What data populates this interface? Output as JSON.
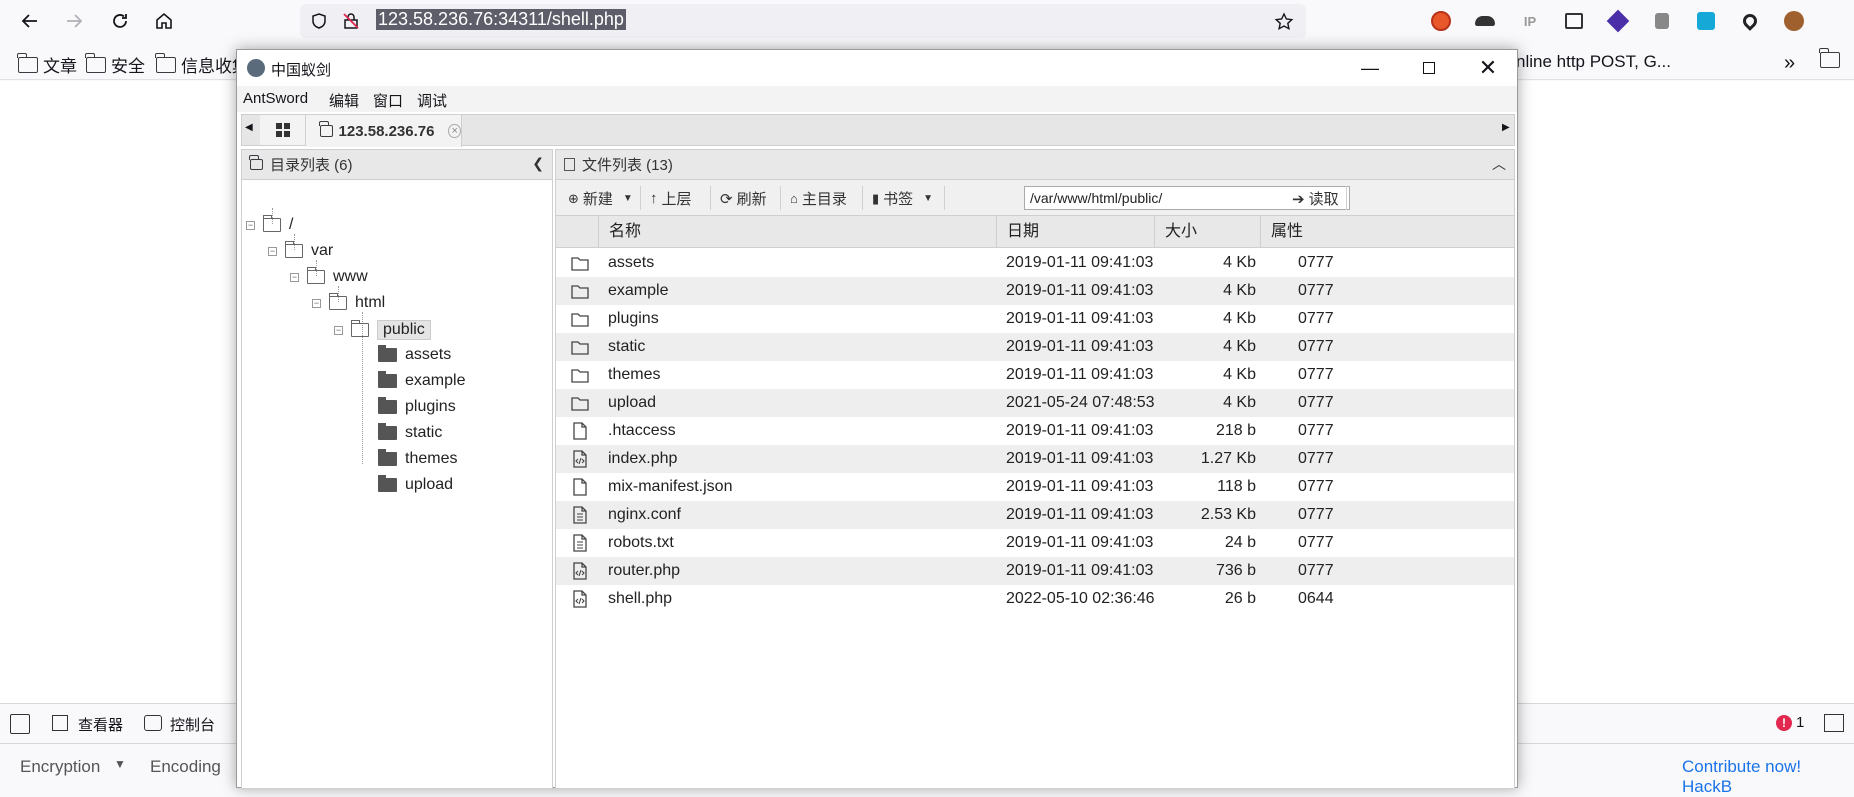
{
  "browser": {
    "url": "123.58.236.76:34311/shell.php",
    "bookmarks": [
      "文章",
      "安全",
      "信息收集"
    ],
    "bookmark_right": "nline http POST, G...",
    "extensions": [
      "ip-ext-label"
    ],
    "ip_label": "IP"
  },
  "antsword": {
    "title": "中国蚁剑",
    "menu": [
      "AntSword",
      "编辑",
      "窗口",
      "调试"
    ],
    "tab_host": "123.58.236.76",
    "dir_panel_title": "目录列表 (6)",
    "file_panel_title": "文件列表 (13)",
    "tree": {
      "root": "/",
      "var": "var",
      "www": "www",
      "html": "html",
      "public": "public",
      "children": [
        "assets",
        "example",
        "plugins",
        "static",
        "themes",
        "upload"
      ]
    },
    "toolbar": {
      "new": "新建",
      "up": "上层",
      "refresh": "刷新",
      "home": "主目录",
      "bookmark": "书签",
      "path": "/var/www/html/public/",
      "read": "读取"
    },
    "columns": {
      "name": "名称",
      "date": "日期",
      "size": "大小",
      "attr": "属性"
    },
    "files": [
      {
        "type": "folder",
        "name": "assets",
        "date": "2019-01-11 09:41:03",
        "size": "4 Kb",
        "attr": "0777"
      },
      {
        "type": "folder",
        "name": "example",
        "date": "2019-01-11 09:41:03",
        "size": "4 Kb",
        "attr": "0777"
      },
      {
        "type": "folder",
        "name": "plugins",
        "date": "2019-01-11 09:41:03",
        "size": "4 Kb",
        "attr": "0777"
      },
      {
        "type": "folder",
        "name": "static",
        "date": "2019-01-11 09:41:03",
        "size": "4 Kb",
        "attr": "0777"
      },
      {
        "type": "folder",
        "name": "themes",
        "date": "2019-01-11 09:41:03",
        "size": "4 Kb",
        "attr": "0777"
      },
      {
        "type": "folder",
        "name": "upload",
        "date": "2021-05-24 07:48:53",
        "size": "4 Kb",
        "attr": "0777"
      },
      {
        "type": "file",
        "name": ".htaccess",
        "date": "2019-01-11 09:41:03",
        "size": "218 b",
        "attr": "0777"
      },
      {
        "type": "code",
        "name": "index.php",
        "date": "2019-01-11 09:41:03",
        "size": "1.27 Kb",
        "attr": "0777"
      },
      {
        "type": "file",
        "name": "mix-manifest.json",
        "date": "2019-01-11 09:41:03",
        "size": "118 b",
        "attr": "0777"
      },
      {
        "type": "text",
        "name": "nginx.conf",
        "date": "2019-01-11 09:41:03",
        "size": "2.53 Kb",
        "attr": "0777"
      },
      {
        "type": "text",
        "name": "robots.txt",
        "date": "2019-01-11 09:41:03",
        "size": "24 b",
        "attr": "0777"
      },
      {
        "type": "code",
        "name": "router.php",
        "date": "2019-01-11 09:41:03",
        "size": "736 b",
        "attr": "0777"
      },
      {
        "type": "code",
        "name": "shell.php",
        "date": "2022-05-10 02:36:46",
        "size": "26 b",
        "attr": "0644"
      }
    ]
  },
  "devtools": {
    "inspector": "查看器",
    "console": "控制台",
    "error_count": "1"
  },
  "hackbar": {
    "encryption": "Encryption",
    "encoding": "Encoding",
    "contribute": "Contribute now! HackB"
  }
}
